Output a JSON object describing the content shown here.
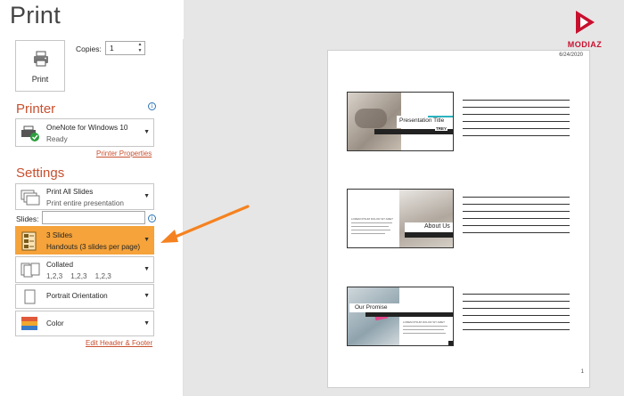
{
  "title": "Print",
  "print_button": {
    "label": "Print"
  },
  "copies": {
    "label": "Copies:",
    "value": "1"
  },
  "printer": {
    "heading": "Printer",
    "name": "OneNote for Windows 10",
    "status": "Ready",
    "properties_link": "Printer Properties"
  },
  "settings": {
    "heading": "Settings",
    "print_range": {
      "title": "Print All Slides",
      "subtitle": "Print entire presentation"
    },
    "slides_label": "Slides:",
    "layout": {
      "title": "3 Slides",
      "subtitle": "Handouts (3 slides per page)"
    },
    "collation": {
      "title": "Collated",
      "subtitle": "1,2,3    1,2,3    1,2,3"
    },
    "orientation": {
      "title": "Portrait Orientation"
    },
    "color": {
      "title": "Color"
    },
    "header_footer_link": "Edit Header & Footer"
  },
  "preview": {
    "date": "6/24/2020",
    "page_number": "1",
    "slides": [
      {
        "title": "Presentation Title",
        "brand": "TREY"
      },
      {
        "title": "About Us",
        "subtext": "LOREM IPSUM DOLOR SIT AMET"
      },
      {
        "title": "Our Promise",
        "subtext": "LOREM IPSUM DOLOR SIT AMET"
      }
    ]
  },
  "logo": {
    "text": "MODIAZ"
  },
  "colors": {
    "accent": "#c7502f",
    "highlight": "#f5a33a",
    "arrow": "#f58220"
  }
}
